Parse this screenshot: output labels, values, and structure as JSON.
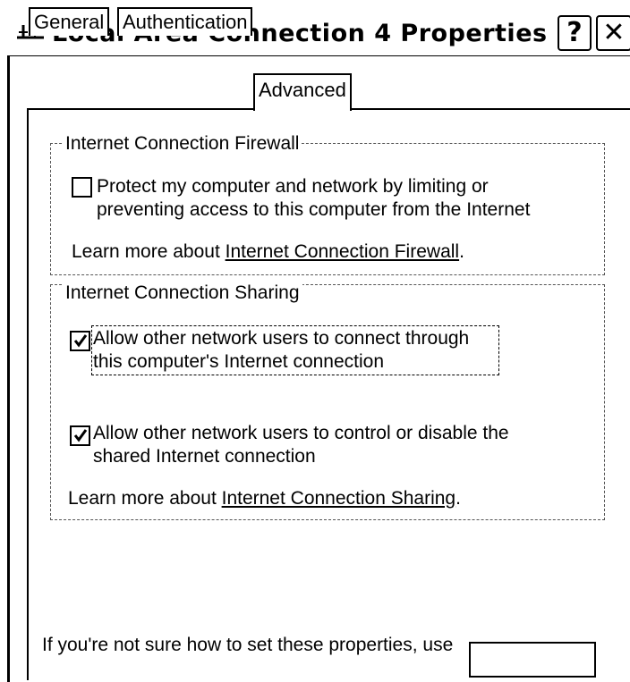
{
  "window": {
    "title": "Local Area Connection 4 Properties",
    "help_label": "?",
    "close_label": "✕"
  },
  "tabs": [
    {
      "label": "General",
      "active": false
    },
    {
      "label": "Authentication",
      "active": false
    },
    {
      "label": "Advanced",
      "active": true
    }
  ],
  "firewall": {
    "group_title": "Internet Connection Firewall",
    "protect_checkbox": {
      "checked": false,
      "label": "Protect my computer and network by limiting or preventing access to this computer from the Internet",
      "mnemonic": "P"
    },
    "learn_more_prefix": "Learn more about ",
    "learn_more_link": "Internet Connection Firewall",
    "learn_more_suffix": "."
  },
  "sharing": {
    "group_title": "Internet Connection Sharing",
    "allow_connect_checkbox": {
      "checked": true,
      "label": "Allow other network users to connect through this computer's Internet connection",
      "mnemonic": "n"
    },
    "allow_control_checkbox": {
      "checked": true,
      "label": "Allow other network users to control or disable the shared Internet connection",
      "mnemonic": "g"
    },
    "learn_more_prefix": "Learn more about ",
    "learn_more_link": "Internet Connection Sharing",
    "learn_more_suffix": "."
  },
  "footer": {
    "text": "If you're not sure how to set these properties, use"
  },
  "colors": {
    "background": "#ffffff",
    "foreground": "#000000"
  }
}
